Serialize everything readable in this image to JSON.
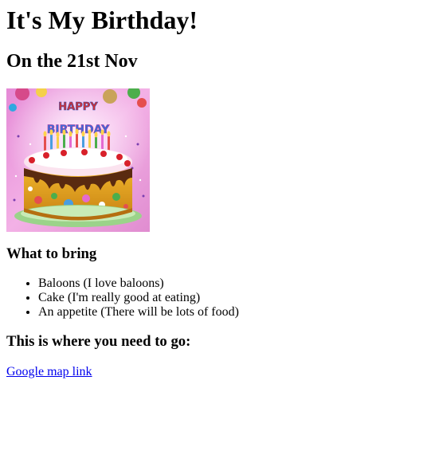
{
  "page": {
    "title": "It's My Birthday!",
    "subtitle": "On the 21st Nov",
    "image_alt": "Happy Birthday cake",
    "image_text_top": "HAPPY",
    "image_text_bottom": "BIRTHDAY"
  },
  "bring": {
    "heading": "What to bring",
    "items": [
      "Baloons (I love baloons)",
      "Cake (I'm really good at eating)",
      "An appetite (There will be lots of food)"
    ]
  },
  "location": {
    "heading": "This is where you need to go:",
    "link_text": "Google map link"
  }
}
